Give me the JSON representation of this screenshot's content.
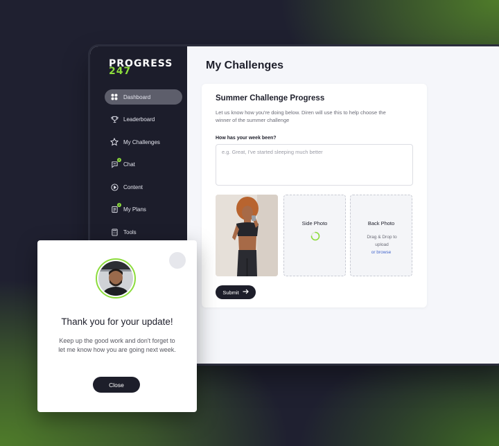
{
  "brand": {
    "line1": "PROGRESS",
    "line2": "247",
    "accent": "#8cdc3c"
  },
  "sidebar": {
    "items": [
      {
        "label": "Dashboard",
        "icon": "dashboard-icon",
        "active": true
      },
      {
        "label": "Leaderboard",
        "icon": "trophy-icon"
      },
      {
        "label": "My Challenges",
        "icon": "star-icon"
      },
      {
        "label": "Chat",
        "icon": "chat-icon",
        "badge": "2"
      },
      {
        "label": "Content",
        "icon": "play-icon"
      },
      {
        "label": "My Plans",
        "icon": "plans-icon",
        "badge": "2"
      },
      {
        "label": "Tools",
        "icon": "calculator-icon"
      }
    ]
  },
  "page": {
    "title": "My Challenges"
  },
  "card": {
    "title": "Summer Challenge Progress",
    "description": "Let us know how you're doing below. Diren will use this to help choose the winner of the summer challenge",
    "question": "How has your week been?",
    "placeholder": "e.g. Great, I've started sleeping much better",
    "photos": {
      "side_label": "Side Photo",
      "back_label": "Back Photo",
      "back_hint": "Drag & Drop to upload",
      "back_link": "or browse"
    },
    "submit_label": "Submit"
  },
  "modal": {
    "title": "Thank you for your update!",
    "message": "Keep up the good work and don't forget to let me know how you are going next week.",
    "close_label": "Close"
  }
}
